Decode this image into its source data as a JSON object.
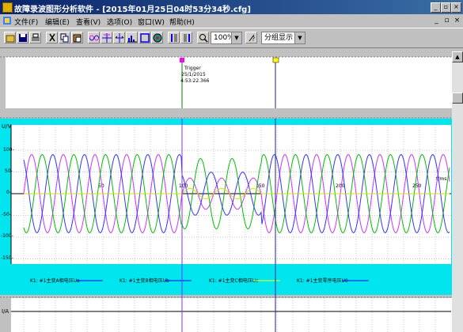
{
  "window": {
    "title": "故障录波图形分析软件 - [2015年01月25日04时53分34秒.cfg]",
    "minimize": "_",
    "restore": "▫",
    "close": "×"
  },
  "menu": {
    "items": [
      {
        "key": "file",
        "label": "文件(F)"
      },
      {
        "key": "edit",
        "label": "编辑(E)"
      },
      {
        "key": "view",
        "label": "查看(V)"
      },
      {
        "key": "options",
        "label": "选项(O)"
      },
      {
        "key": "window",
        "label": "窗口(W)"
      },
      {
        "key": "help",
        "label": "帮助(H)"
      }
    ],
    "mdi_minimize": "_",
    "mdi_restore": "▫",
    "mdi_close": "×"
  },
  "toolbar": {
    "zoom_value": "100%",
    "display_mode": "分组显示",
    "icons": [
      "open-icon",
      "save-icon",
      "print-icon",
      "cut-icon",
      "copy-icon",
      "paste-icon",
      "waveform-icon",
      "cursor-add-icon",
      "cursor-move-icon",
      "spectrum-icon",
      "rectangle-icon",
      "color-icon",
      "cursor-left-icon",
      "cursor-right-icon",
      "zoom-icon",
      "help-icon"
    ]
  },
  "trigger_panel": {
    "label": "Trigger",
    "date": "25/1/2015",
    "time": "4:53:22.366"
  },
  "voltage_panel": {
    "unit_label": "U/V",
    "x_unit": "t/ms",
    "background": "#00e5ee",
    "y_ticks": [
      "100-",
      "50-",
      "0-",
      "-50-",
      "-100-",
      "-150-"
    ],
    "x_ticks": [
      "50",
      "100",
      "150",
      "200",
      "250"
    ],
    "legend": [
      {
        "label": "K1: #1主变A相电压Ua",
        "color": "#0000ff"
      },
      {
        "label": "K1: #1主变B相电压Ub",
        "color": "#0000ff"
      },
      {
        "label": "K1: #1主变C相电压Uc",
        "color": "#ffff00"
      },
      {
        "label": "K1: #1主变零序电压U0",
        "color": "#0000ff"
      }
    ],
    "series_colors": {
      "Ua": "#cc33ff",
      "Ub": "#00c000",
      "Uc": "#3333ff",
      "U0": "#dddd00"
    }
  },
  "current_panel": {
    "unit_label": "I/A"
  },
  "cursor_colors": {
    "left": "#8030ff",
    "right": "#2020a0",
    "trigger": "#008000"
  }
}
